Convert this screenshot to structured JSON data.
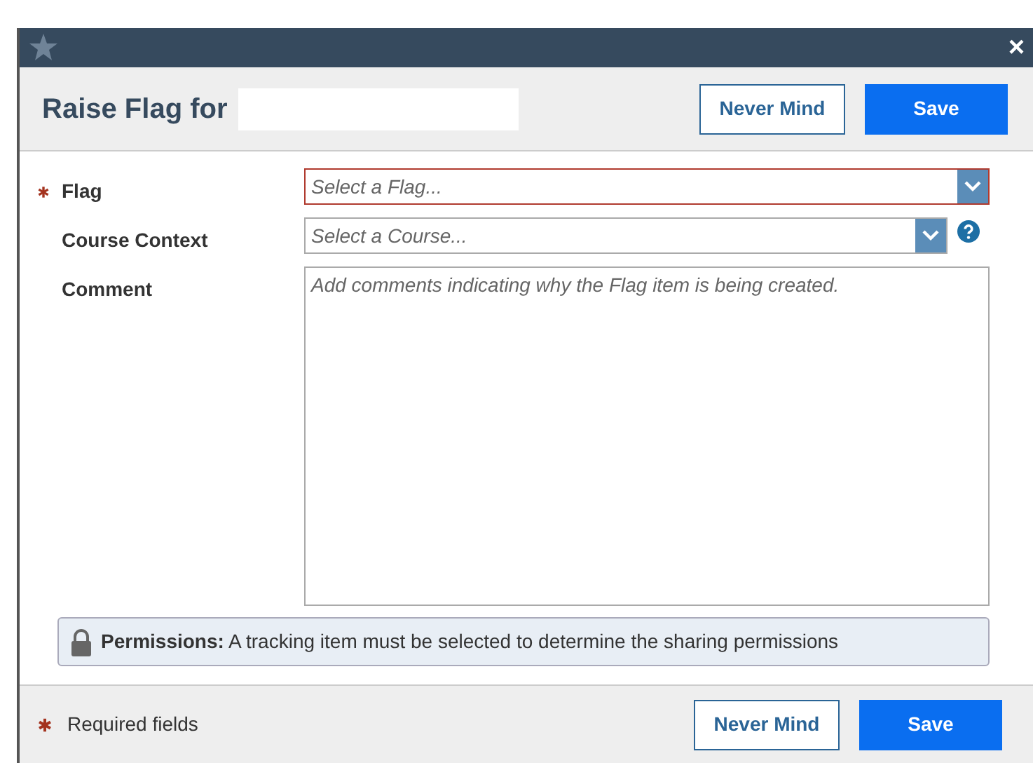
{
  "window": {
    "close": "×"
  },
  "header": {
    "title": "Raise Flag for",
    "buttons": [
      {
        "label": "Never Mind",
        "kind": "secondary"
      },
      {
        "label": "Save",
        "kind": "primary"
      }
    ]
  },
  "fields": [
    {
      "label": "Flag",
      "kind": "select",
      "placeholder": "Select a Flag...",
      "required": true,
      "invalid": true,
      "help": false
    },
    {
      "label": "Course Context",
      "kind": "select",
      "placeholder": "Select a Course...",
      "required": false,
      "invalid": false,
      "help": true
    },
    {
      "label": "Comment",
      "kind": "textarea",
      "placeholder": "Add comments indicating why the Flag item is being created.",
      "required": false,
      "help": false
    }
  ],
  "permissions": {
    "label": "Permissions:",
    "text": "A tracking item must be selected to determine the sharing permissions"
  },
  "footer": {
    "required_note": "Required fields",
    "buttons": [
      {
        "label": "Never Mind",
        "kind": "secondary"
      },
      {
        "label": "Save",
        "kind": "primary"
      }
    ]
  }
}
